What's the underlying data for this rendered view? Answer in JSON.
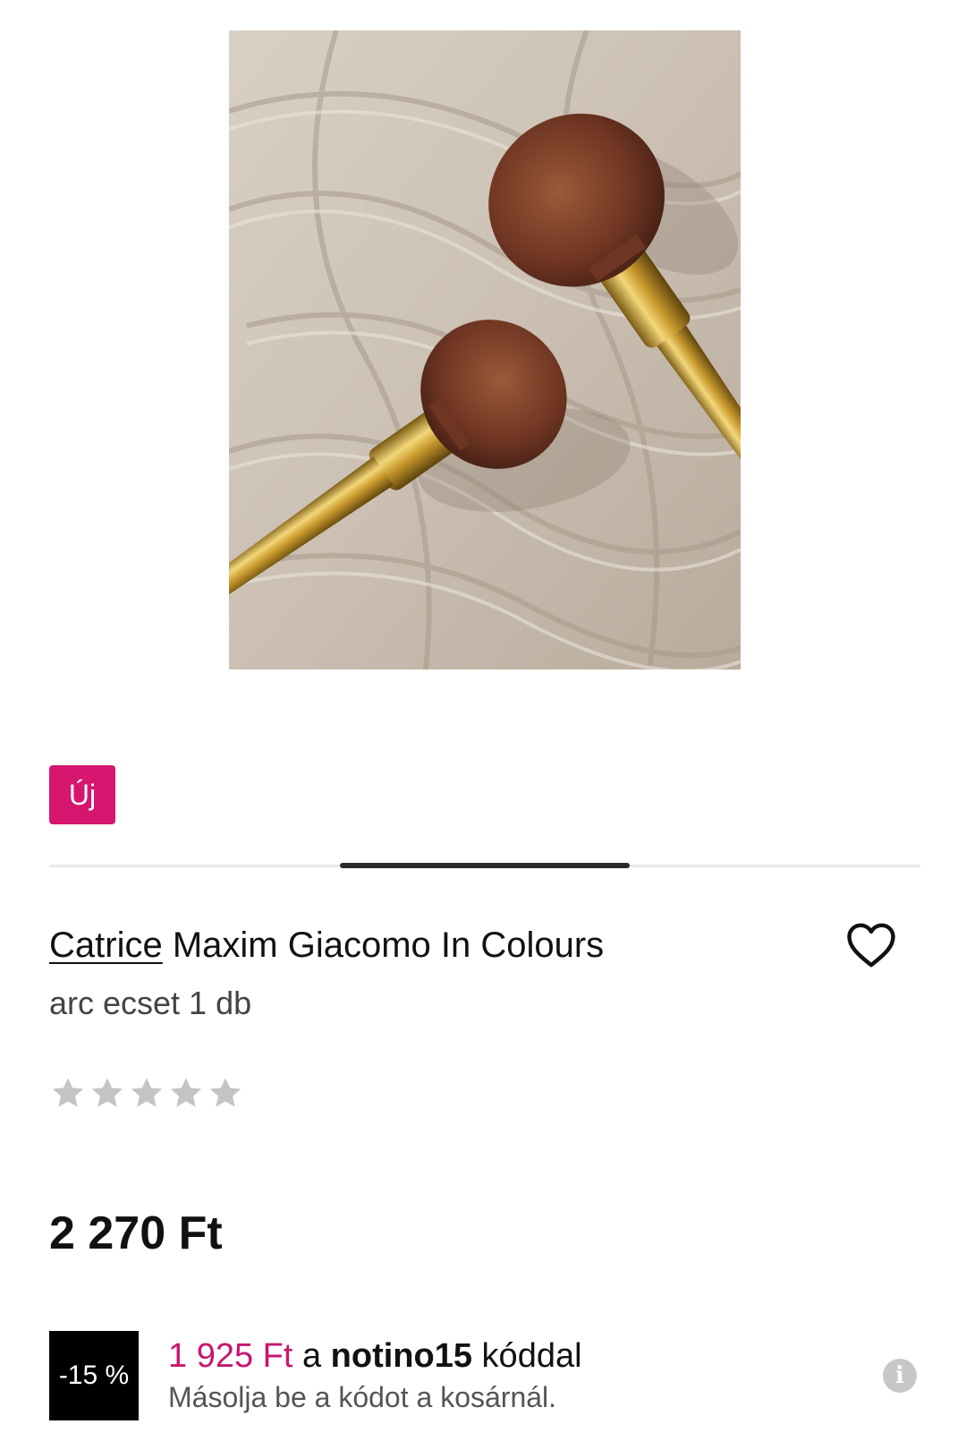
{
  "product": {
    "image_alt": "Catrice Maxim Giacomo In Colours arc ecset",
    "badge_new": "Új",
    "brand": "Catrice",
    "name": " Maxim Giacomo In Colours",
    "subtitle": "arc ecset 1 db",
    "rating": {
      "value": 0,
      "max": 5
    },
    "price": "2 270 Ft",
    "wishlist_icon": "heart-outline-icon"
  },
  "promo": {
    "discount": "-15 %",
    "price": "1 925 Ft",
    "text_a": " a ",
    "code": "notino15",
    "text_b": " kóddal",
    "hint": "Másolja be a kódot a kosárnál.",
    "info_icon": "info-icon"
  },
  "colors": {
    "accent": "#D6156F",
    "promo_price": "#C8166F",
    "star_empty": "#C4C4C4",
    "discount_bg": "#000000"
  }
}
